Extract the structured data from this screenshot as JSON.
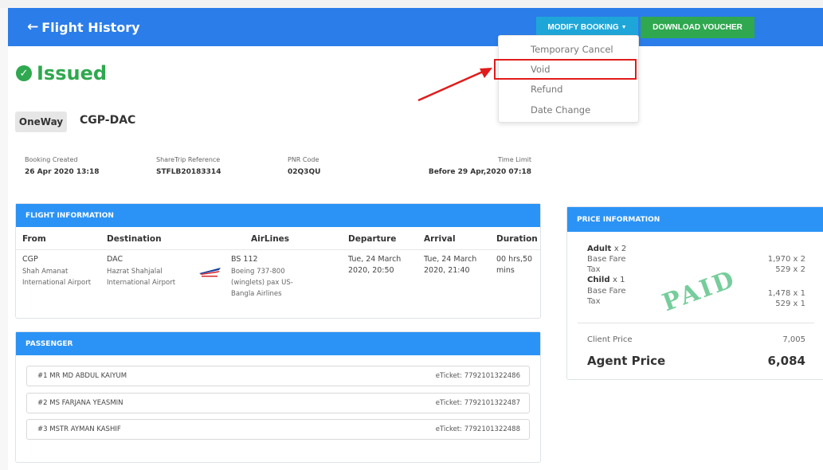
{
  "header": {
    "back_arrow": "←",
    "title": "Flight History",
    "modify_button": "MODIFY BOOKING",
    "download_button": "DOWNLOAD VOUCHER"
  },
  "modify_menu": {
    "items": [
      "Temporary Cancel",
      "Void",
      "Refund",
      "Date Change"
    ]
  },
  "status": {
    "icon": "check-circle-icon",
    "text": "Issued",
    "color": "#2fa84f"
  },
  "trip": {
    "type": "OneWay",
    "route": "CGP-DAC"
  },
  "booking_meta": {
    "booking_created_label": "Booking Created",
    "booking_created_value": "26 Apr 2020 13:18",
    "sharetrip_ref_label": "ShareTrip Reference",
    "sharetrip_ref_value": "STFLB20183314",
    "pnr_label": "PNR Code",
    "pnr_value": "02Q3QU",
    "time_limit_label": "Time Limit",
    "time_limit_value": "Before 29 Apr,2020 07:18"
  },
  "flight_info": {
    "heading": "FLIGHT INFORMATION",
    "columns": [
      "From",
      "Destination",
      "AirLines",
      "Departure",
      "Arrival",
      "Duration"
    ],
    "row": {
      "from_code": "CGP",
      "from_line1": "Shah Amanat",
      "from_line2": "International Airport",
      "dest_code": "DAC",
      "dest_line1": "Hazrat Shahjalal",
      "dest_line2": "International Airport",
      "flight_no": "BS 112",
      "aircraft_line1": "Boeing 737-800",
      "aircraft_line2": "(winglets) pax US-",
      "aircraft_line3": "Bangla Airlines",
      "departure_line1": "Tue, 24 March",
      "departure_line2": "2020, 20:50",
      "arrival_line1": "Tue, 24 March",
      "arrival_line2": "2020, 21:40",
      "duration_line1": "00 hrs,50",
      "duration_line2": "mins"
    }
  },
  "passengers": {
    "heading": "PASSENGER",
    "list": [
      {
        "name": "#1 MR MD ABDUL KAIYUM",
        "ticket": "eTicket: 7792101322486"
      },
      {
        "name": "#2 MS FARJANA YEASMIN",
        "ticket": "eTicket: 7792101322487"
      },
      {
        "name": "#3 MSTR AYMAN KASHIF",
        "ticket": "eTicket: 7792101322488"
      }
    ]
  },
  "price": {
    "heading": "PRICE INFORMATION",
    "adult_label": "Adult",
    "adult_count": "x 2",
    "adult_base_label": "Base Fare",
    "adult_base_value": "1,970 x 2",
    "adult_tax_label": "Tax",
    "adult_tax_value": "529 x 2",
    "child_label": "Child",
    "child_count": "x 1",
    "child_base_label": "Base Fare",
    "child_base_value": "1,478 x 1",
    "child_tax_label": "Tax",
    "child_tax_value": "529 x 1",
    "client_price_label": "Client Price",
    "client_price_value": "7,005",
    "agent_price_label": "Agent Price",
    "agent_price_value": "6,084",
    "stamp": "PAID"
  },
  "colors": {
    "topbar": "#2b7de9",
    "modify_button": "#1fa6d8",
    "download_button": "#2fa84f",
    "panel_header": "#2b93f5",
    "annotation_red": "#e11b1b"
  }
}
